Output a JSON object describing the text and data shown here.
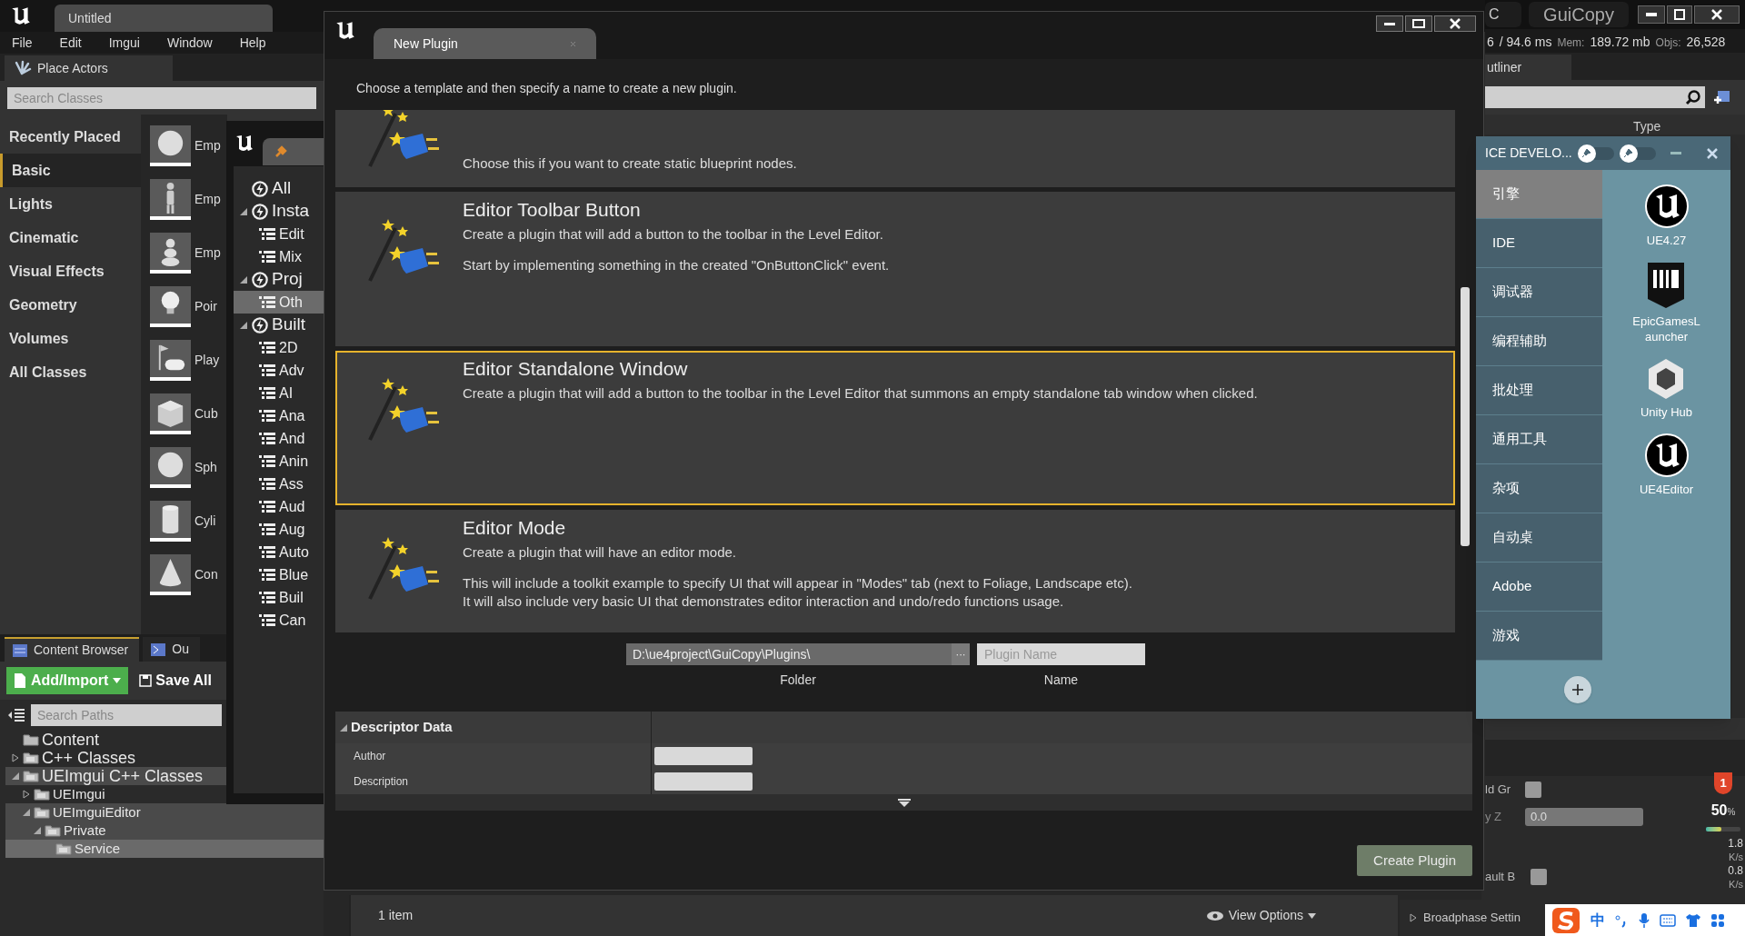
{
  "editor": {
    "tab": "Untitled",
    "menu": [
      "File",
      "Edit",
      "Imgui",
      "Window",
      "Help"
    ],
    "place_actors": {
      "tab": "Place Actors",
      "search": {
        "placeholder": "Search Classes"
      },
      "categories": [
        {
          "label": "Recently Placed",
          "selected": false
        },
        {
          "label": "Basic",
          "selected": true
        },
        {
          "label": "Lights",
          "selected": false
        },
        {
          "label": "Cinematic",
          "selected": false
        },
        {
          "label": "Visual Effects",
          "selected": false
        },
        {
          "label": "Geometry",
          "selected": false
        },
        {
          "label": "Volumes",
          "selected": false
        },
        {
          "label": "All Classes",
          "selected": false
        }
      ],
      "actors": [
        {
          "label": "Emp",
          "kind": "sphere"
        },
        {
          "label": "Emp",
          "kind": "figure"
        },
        {
          "label": "Emp",
          "kind": "pawn"
        },
        {
          "label": "Poir",
          "kind": "bulb"
        },
        {
          "label": "Play",
          "kind": "gamepad"
        },
        {
          "label": "Cub",
          "kind": "cube"
        },
        {
          "label": "Sph",
          "kind": "sphere"
        },
        {
          "label": "Cyli",
          "kind": "cylinder"
        },
        {
          "label": "Con",
          "kind": "cone"
        }
      ]
    },
    "content_browser": {
      "tabs": [
        "Content Browser",
        "Ou"
      ],
      "add_button": "Add/Import",
      "save_button": "Save All",
      "search": {
        "placeholder": "Search Paths"
      },
      "tree": [
        {
          "label": "Content",
          "kind": "folder",
          "selected": false
        },
        {
          "label": "C++ Classes",
          "kind": "code",
          "expanded": false,
          "selected": false
        },
        {
          "label": "UEImgui C++ Classes",
          "kind": "code",
          "expanded": true,
          "selected": false,
          "children": [
            {
              "label": "UEImgui",
              "kind": "code",
              "expanded": false,
              "selected": false
            },
            {
              "label": "UEImguiEditor",
              "kind": "code",
              "expanded": true,
              "selected": false,
              "children": [
                {
                  "label": "Private",
                  "kind": "code",
                  "expanded": true,
                  "selected": false,
                  "children": [
                    {
                      "label": "Service",
                      "kind": "code",
                      "selected": true
                    }
                  ]
                }
              ]
            }
          ]
        }
      ]
    },
    "status_bar": {
      "count": "1 item",
      "view_options": "View Options"
    }
  },
  "plugin_browser": {
    "tree": [
      {
        "label": "All",
        "selected": false
      },
      {
        "label": "Insta",
        "expanded": true,
        "selected": false,
        "children": [
          {
            "label": "Edit",
            "selected": false
          },
          {
            "label": "Mix",
            "selected": false
          }
        ]
      },
      {
        "label": "Proj",
        "expanded": true,
        "selected": false,
        "children": [
          {
            "label": "Oth",
            "selected": true
          }
        ]
      },
      {
        "label": "Built",
        "expanded": true,
        "selected": false,
        "children": [
          {
            "label": "2D",
            "selected": false
          },
          {
            "label": "Adv",
            "selected": false
          },
          {
            "label": "AI",
            "selected": false
          },
          {
            "label": "Ana",
            "selected": false
          },
          {
            "label": "And",
            "selected": false
          },
          {
            "label": "Anin",
            "selected": false
          },
          {
            "label": "Ass",
            "selected": false
          },
          {
            "label": "Aud",
            "selected": false
          },
          {
            "label": "Aug",
            "selected": false
          },
          {
            "label": "Auto",
            "selected": false
          },
          {
            "label": "Blue",
            "selected": false
          },
          {
            "label": "Buil",
            "selected": false
          },
          {
            "label": "Can",
            "selected": false
          }
        ]
      }
    ]
  },
  "dialog": {
    "tab": "New Plugin",
    "intro": "Choose a template and then specify a name to create a new plugin.",
    "templates": [
      {
        "paragraphs": [
          [
            "Choose this if you want to create static blueprint nodes."
          ]
        ],
        "selected": false
      },
      {
        "title": "Editor Toolbar Button",
        "paragraphs": [
          [
            "Create a plugin that will add a button to the toolbar in the Level Editor."
          ],
          [
            "Start by implementing something in the created \"OnButtonClick\" event."
          ]
        ],
        "selected": false
      },
      {
        "title": "Editor Standalone Window",
        "paragraphs": [
          [
            "Create a plugin that will add a button to the toolbar in the Level Editor that summons an empty standalone tab window when clicked."
          ]
        ],
        "selected": true
      },
      {
        "title": "Editor Mode",
        "paragraphs": [
          [
            "Create a plugin that will have an editor mode."
          ],
          [
            "This will include a toolkit example to specify UI that will appear in \"Modes\" tab (next to Foliage, Landscape etc).",
            "It will also include very basic UI that demonstrates editor interaction and undo/redo functions usage."
          ]
        ],
        "selected": false
      }
    ],
    "folder": {
      "value": "D:\\ue4project\\GuiCopy\\Plugins\\",
      "browse": "···",
      "label": "Folder"
    },
    "name": {
      "placeholder": "Plugin Name",
      "label": "Name"
    },
    "descriptor": {
      "title": "Descriptor Data",
      "expanded": true,
      "rows": [
        "Author",
        "Description"
      ]
    },
    "create_button": "Create Plugin"
  },
  "right": {
    "tabs": [
      "C",
      "GuiCopy"
    ],
    "stats": [
      "6",
      "/ 94.6 ms",
      "Mem:",
      "189.72 mb",
      "Objs:",
      "26,528"
    ],
    "outliner_tab": "utliner",
    "column": "Type",
    "details": {
      "checkbox_label": "ld Gr",
      "checked": false,
      "field_label": "y Z",
      "field_value": "0.0",
      "cut_label": "ault B",
      "cut_checked": false,
      "section": "Broadphase Settin"
    }
  },
  "ice_panel": {
    "title": "ICE DEVELO...",
    "toggles": [
      {
        "on": false
      },
      {
        "on": false
      }
    ],
    "categories": [
      {
        "label": "引擎",
        "selected": true
      },
      {
        "label": "IDE",
        "selected": false
      },
      {
        "label": "调试器",
        "selected": false
      },
      {
        "label": "编程辅助",
        "selected": false
      },
      {
        "label": "批处理",
        "selected": false
      },
      {
        "label": "通用工具",
        "selected": false
      },
      {
        "label": "杂项",
        "selected": false
      },
      {
        "label": "自动桌",
        "selected": false
      },
      {
        "label": "Adobe",
        "selected": false
      },
      {
        "label": "游戏",
        "selected": false
      }
    ],
    "apps": [
      {
        "label": "UE4.27",
        "kind": "unreal"
      },
      {
        "label": "EpicGamesL\nauncher",
        "kind": "epic"
      },
      {
        "label": "Unity Hub",
        "kind": "unity"
      },
      {
        "label": "UE4Editor",
        "kind": "unreal"
      }
    ]
  },
  "tray": {
    "badge": "1",
    "cpu": "50",
    "cpu_unit": "%",
    "level": 0.45,
    "up": "1.8",
    "up_unit": "K/s",
    "down": "0.8",
    "down_unit": "K/s",
    "ime": "中"
  }
}
